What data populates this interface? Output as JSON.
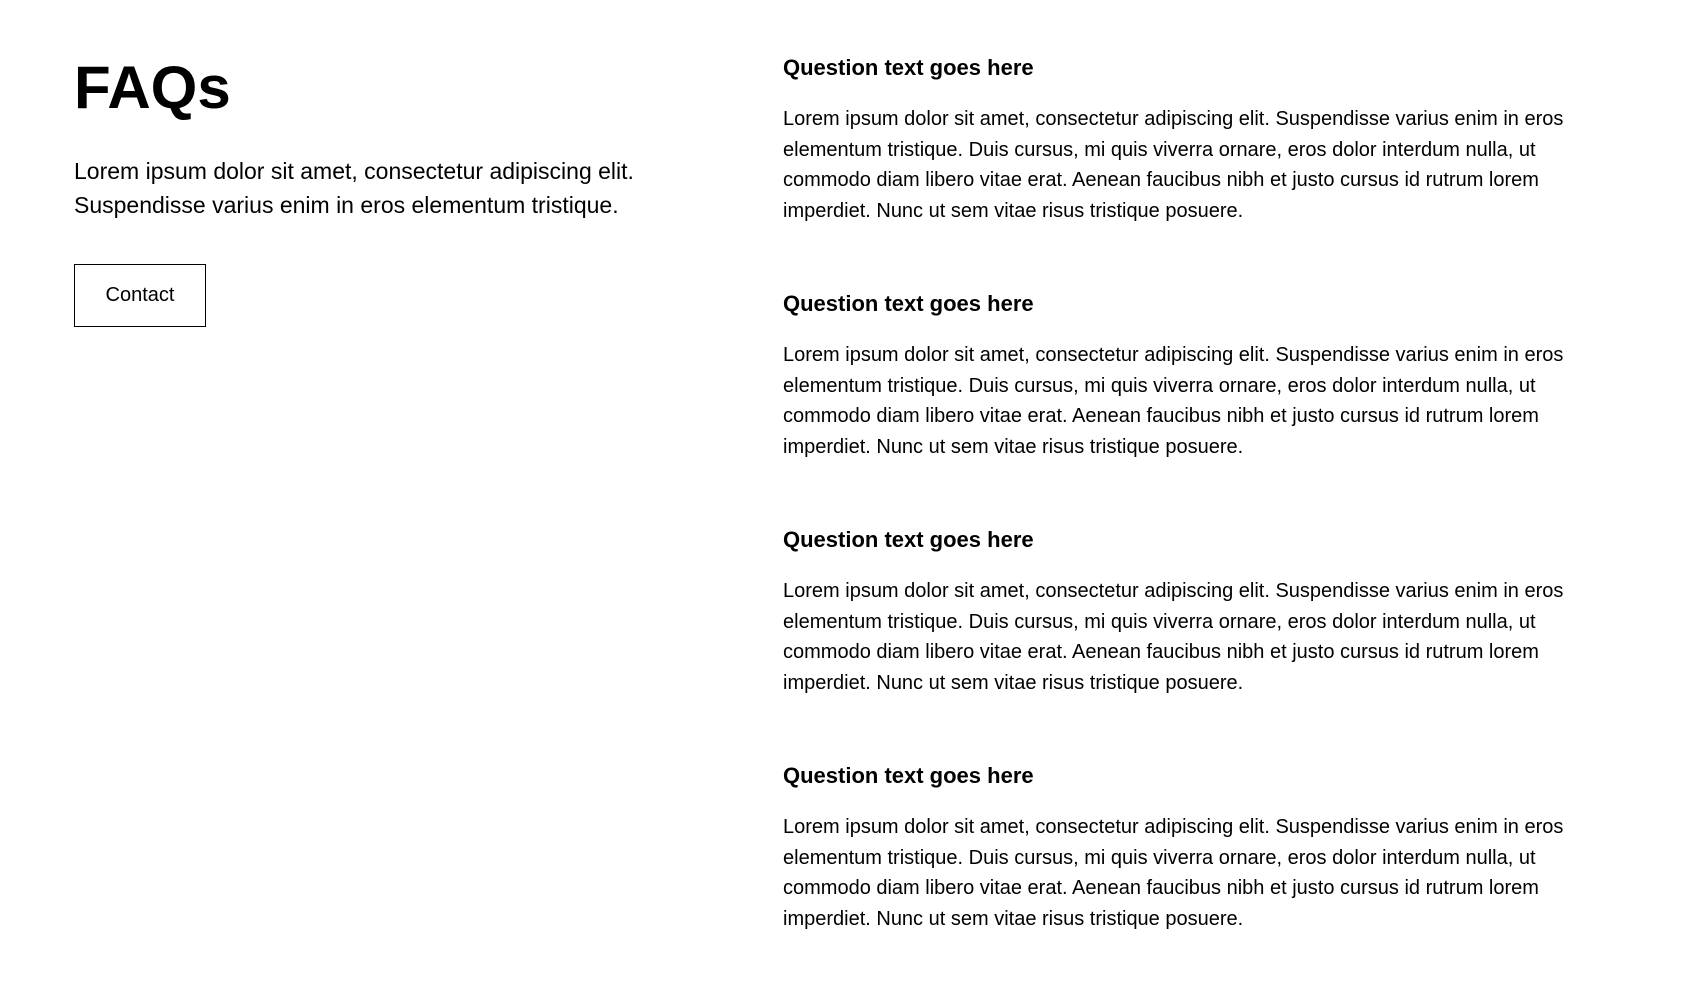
{
  "header": {
    "title": "FAQs",
    "intro": "Lorem ipsum dolor sit amet, consectetur adipiscing elit. Suspendisse varius enim in eros elementum tristique.",
    "contact_label": "Contact"
  },
  "faqs": [
    {
      "question": "Question text goes here",
      "answer": "Lorem ipsum dolor sit amet, consectetur adipiscing elit. Suspendisse varius enim in eros elementum tristique. Duis cursus, mi quis viverra ornare, eros dolor interdum nulla, ut commodo diam libero vitae erat. Aenean faucibus nibh et justo cursus id rutrum lorem imperdiet. Nunc ut sem vitae risus tristique posuere."
    },
    {
      "question": "Question text goes here",
      "answer": "Lorem ipsum dolor sit amet, consectetur adipiscing elit. Suspendisse varius enim in eros elementum tristique. Duis cursus, mi quis viverra ornare, eros dolor interdum nulla, ut commodo diam libero vitae erat. Aenean faucibus nibh et justo cursus id rutrum lorem imperdiet. Nunc ut sem vitae risus tristique posuere."
    },
    {
      "question": "Question text goes here",
      "answer": "Lorem ipsum dolor sit amet, consectetur adipiscing elit. Suspendisse varius enim in eros elementum tristique. Duis cursus, mi quis viverra ornare, eros dolor interdum nulla, ut commodo diam libero vitae erat. Aenean faucibus nibh et justo cursus id rutrum lorem imperdiet. Nunc ut sem vitae risus tristique posuere."
    },
    {
      "question": "Question text goes here",
      "answer": "Lorem ipsum dolor sit amet, consectetur adipiscing elit. Suspendisse varius enim in eros elementum tristique. Duis cursus, mi quis viverra ornare, eros dolor interdum nulla, ut commodo diam libero vitae erat. Aenean faucibus nibh et justo cursus id rutrum lorem imperdiet. Nunc ut sem vitae risus tristique posuere."
    }
  ]
}
